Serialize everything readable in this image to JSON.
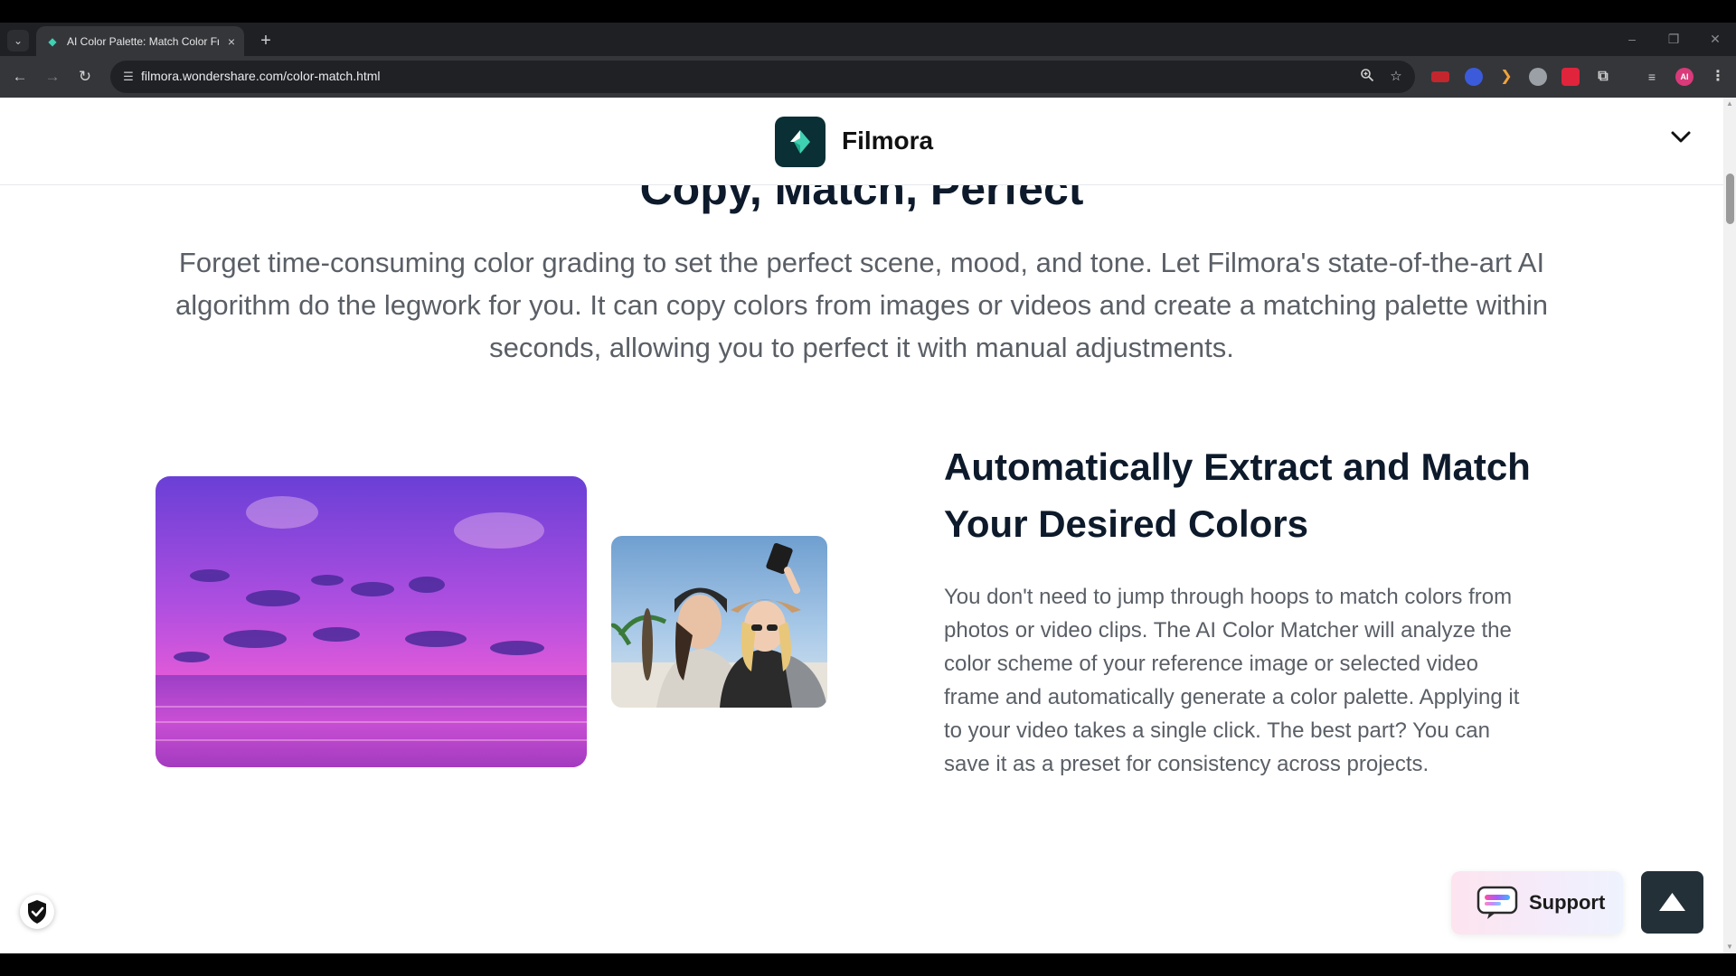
{
  "browser": {
    "tab_list_icon": "chevron-down-icon",
    "tab_title": "AI Color Palette: Match Color Fr",
    "tab_close": "×",
    "new_tab": "+",
    "url": "filmora.wondershare.com/color-match.html",
    "window_controls": [
      "–",
      "❐",
      "✕"
    ],
    "nav": {
      "back": "←",
      "forward": "→",
      "reload": "↻"
    },
    "profile_initials": "AI"
  },
  "site": {
    "brand": "Filmora",
    "accent": "#3ed1b2",
    "logo_bg": "#0a2f35"
  },
  "main": {
    "section_title": "Copy, Match, Perfect",
    "section_description": "Forget time-consuming color grading to set the perfect scene, mood, and tone. Let Filmora's state-of-the-art AI algorithm do the legwork for you. It can copy colors from images or videos and create a matching palette within seconds, allowing you to perfect it with manual adjustments.",
    "feature_title": "Automatically Extract and Match Your Desired Colors",
    "feature_description": "You don't need to jump through hoops to match colors from photos or video clips. The AI Color Matcher will analyze the color scheme of your reference image or selected video frame and automatically generate a color palette. Applying it to your video takes a single click. The best part? You can save it as a preset for consistency across projects."
  },
  "floating": {
    "support_label": "Support",
    "back_to_top_icon": "triangle-up-icon",
    "security_badge_icon": "shield-check-icon"
  }
}
